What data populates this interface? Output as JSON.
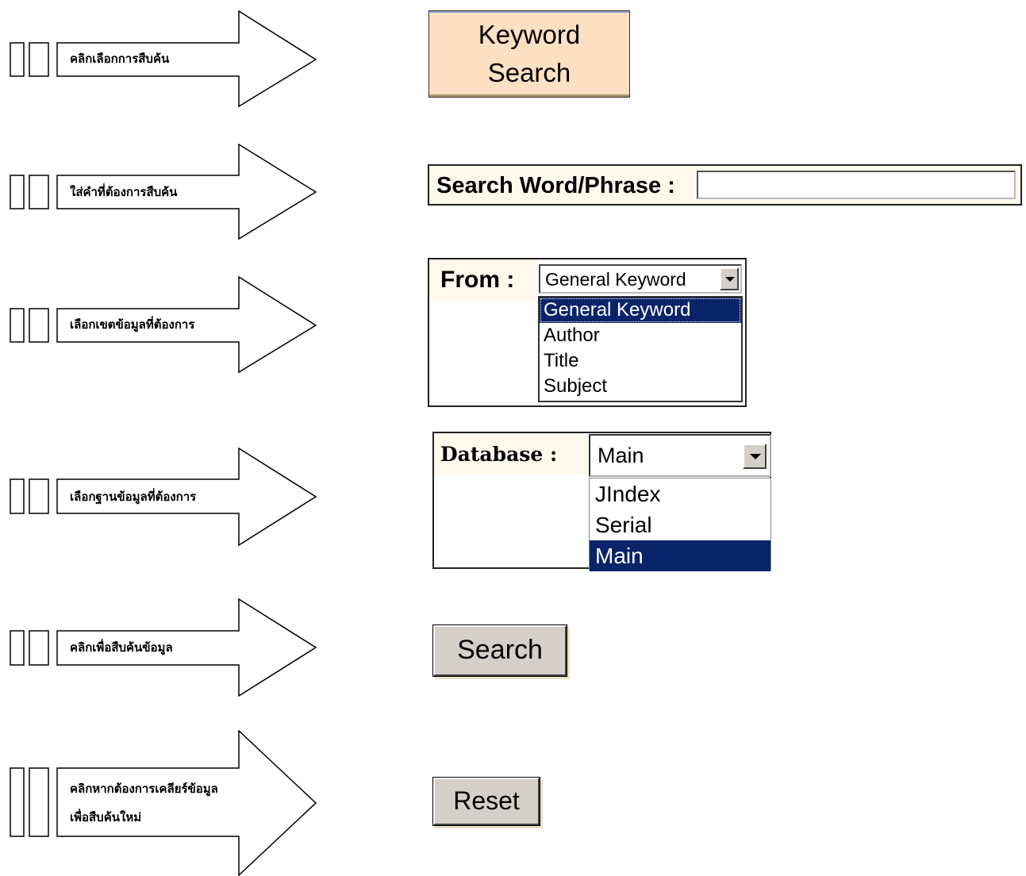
{
  "steps": [
    {
      "label": "คลิกเลือกการสืบค้น"
    },
    {
      "label": "ใส่คำที่ต้องการสืบค้น"
    },
    {
      "label": "เลือกเขตข้อมูลที่ต้องการ"
    },
    {
      "label": "เลือกฐานข้อมูลที่ต้องการ"
    },
    {
      "label": "คลิกเพื่อสืบค้นข้อมูล"
    },
    {
      "label_line1": "คลิกหากต้องการเคลียร์ข้อมูล",
      "label_line2": "เพื่อสืบค้นใหม่"
    }
  ],
  "keyword_search": {
    "label": "Keyword\nSearch"
  },
  "search_word": {
    "label": "Search Word/Phrase :",
    "value": ""
  },
  "from": {
    "label": "From :",
    "selected": "General Keyword",
    "options": [
      "General Keyword",
      "Author",
      "Title",
      "Subject"
    ]
  },
  "database": {
    "label": "Database :",
    "selected": "Main",
    "options": [
      "JIndex",
      "Serial",
      "Main"
    ]
  },
  "buttons": {
    "search": "Search",
    "reset": "Reset"
  }
}
